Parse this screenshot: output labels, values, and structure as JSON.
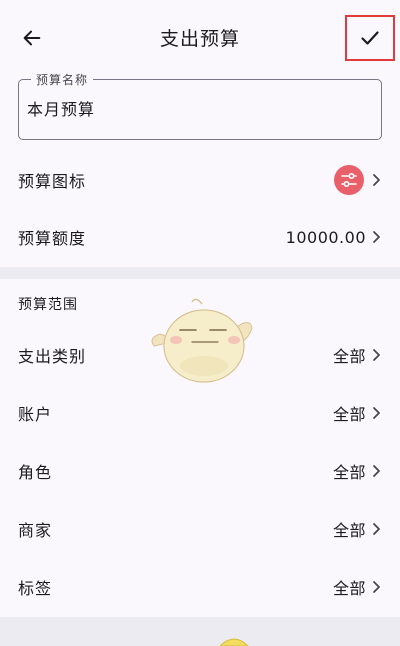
{
  "appbar": {
    "title": "支出预算"
  },
  "name_field": {
    "label": "预算名称",
    "value": "本月预算"
  },
  "budget_icon_row": {
    "label": "预算图标",
    "icon_color": "#E8616A",
    "icon": "sliders-icon"
  },
  "amount_row": {
    "label": "预算额度",
    "value": "10000.00"
  },
  "scope_section": {
    "title": "预算范围",
    "items": [
      {
        "label": "支出类别",
        "value": "全部"
      },
      {
        "label": "账户",
        "value": "全部"
      },
      {
        "label": "角色",
        "value": "全部"
      },
      {
        "label": "商家",
        "value": "全部"
      },
      {
        "label": "标签",
        "value": "全部"
      }
    ]
  },
  "colors": {
    "accent_red": "#E0393E",
    "background": "#FBF8FD",
    "band": "#EDEBF2"
  }
}
